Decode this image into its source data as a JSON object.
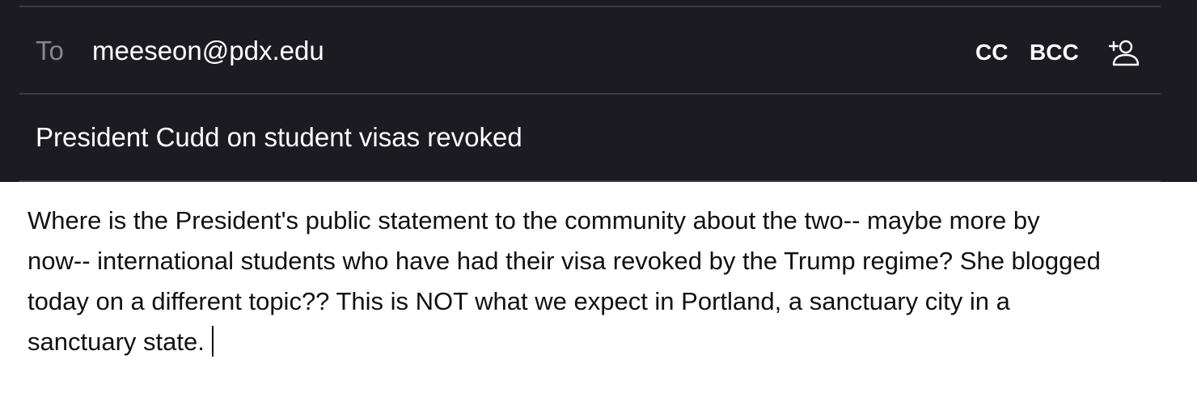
{
  "compose": {
    "to_label": "To",
    "to_value": "meeseon@pdx.edu",
    "cc_label": "CC",
    "bcc_label": "BCC",
    "add_contact_icon": "add-person-icon",
    "subject": "President Cudd on student visas revoked",
    "body_lines": [
      "Where is the President's public statement to the community about the two-- maybe more by",
      "now-- international students who have had their visa revoked by the Trump regime? She blogged",
      "today on a different topic?? This is NOT what we expect in Portland, a sanctuary city in a",
      "sanctuary state."
    ]
  },
  "colors": {
    "header_bg": "#1c1b22",
    "divider": "#3b3a42",
    "label_muted": "#86858e",
    "header_text": "#ffffff",
    "body_text": "#111111",
    "body_bg": "#ffffff"
  }
}
